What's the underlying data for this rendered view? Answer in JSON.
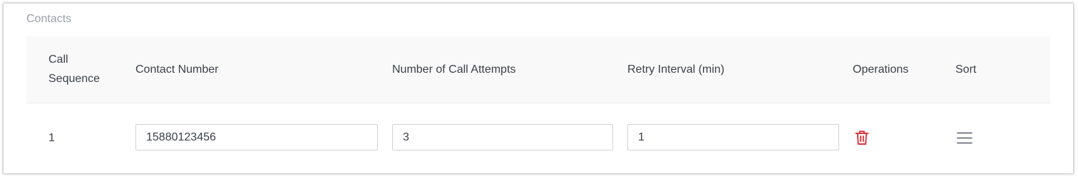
{
  "section": {
    "title": "Contacts"
  },
  "table": {
    "headers": {
      "call_sequence_line1": "Call",
      "call_sequence_line2": "Sequence",
      "contact_number": "Contact Number",
      "call_attempts": "Number of Call Attempts",
      "retry_interval": "Retry Interval (min)",
      "operations": "Operations",
      "sort": "Sort"
    },
    "rows": [
      {
        "sequence": "1",
        "contact_number": "15880123456",
        "call_attempts": "3",
        "retry_interval": "1",
        "operations_icon": "trash-icon",
        "sort_icon": "drag-handle-icon"
      }
    ]
  },
  "colors": {
    "delete_icon": "#d9363e",
    "sort_icon": "#6b6f78",
    "section_title": "#9a9eaa",
    "header_bg": "#f9f9f9"
  }
}
